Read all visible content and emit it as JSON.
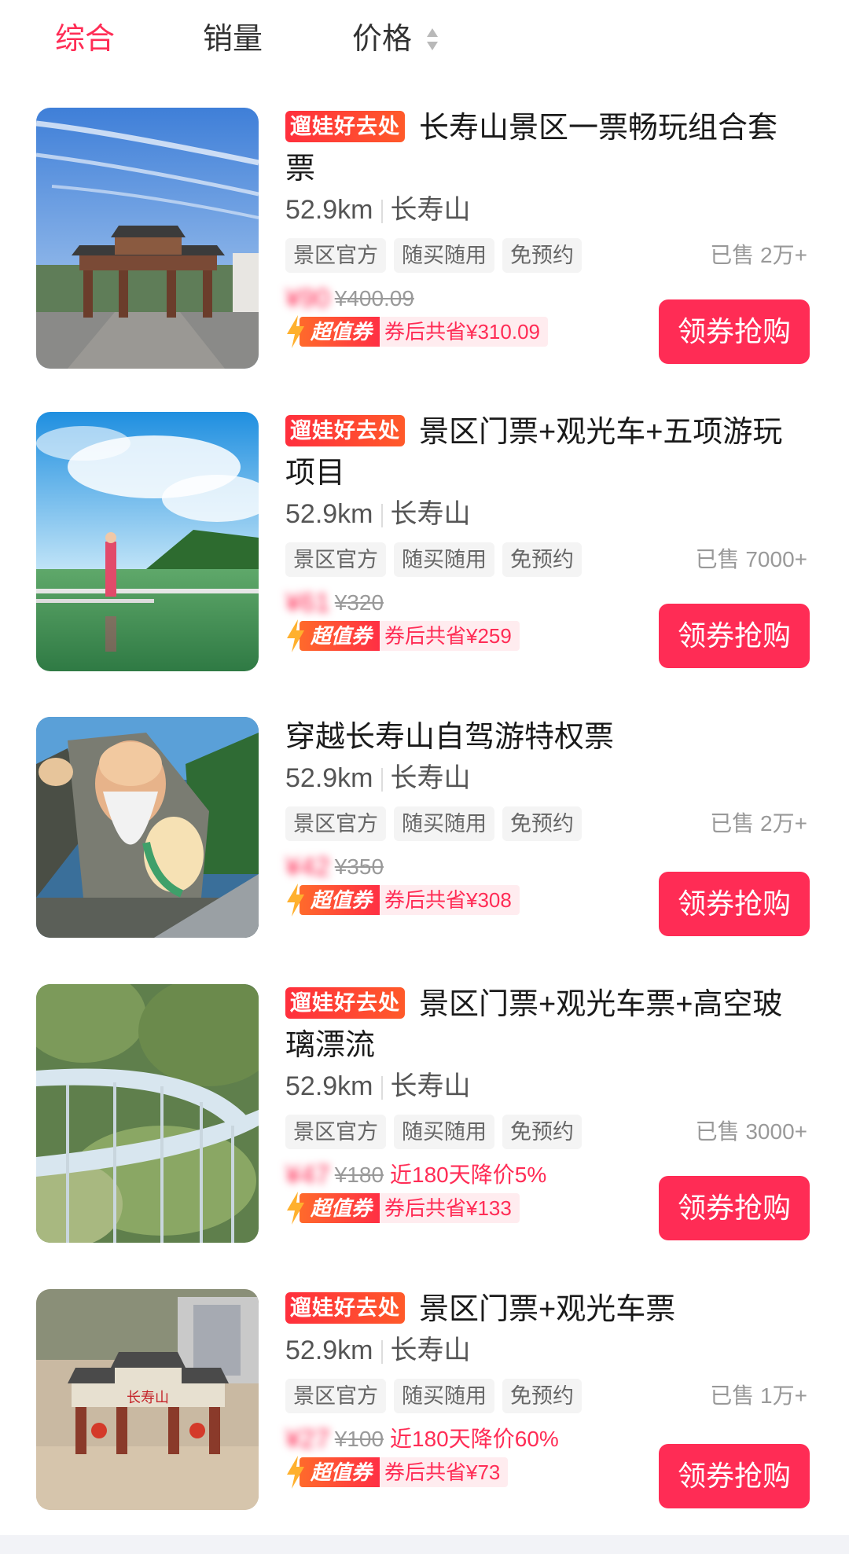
{
  "sort": {
    "items": [
      "综合",
      "销量",
      "价格"
    ],
    "active_index": 0
  },
  "colors": {
    "accent": "#ff2c55",
    "badge": "#ff3a33"
  },
  "products": [
    {
      "badge": "遛娃好去处",
      "title": "长寿山景区一票畅玩组合套票",
      "distance": "52.9km",
      "area": "长寿山",
      "tags": [
        "景区官方",
        "随买随用",
        "免预约"
      ],
      "sold": "已售 2万+",
      "price": "¥90",
      "original_price": "¥400.09",
      "price_drop": "",
      "coupon_label": "超值券",
      "coupon_save": "券后共省¥310.09",
      "buy_label": "领券抢购",
      "image": "arch-gate-blue-sky"
    },
    {
      "badge": "遛娃好去处",
      "title": "景区门票+观光车+五项游玩项目",
      "distance": "52.9km",
      "area": "长寿山",
      "tags": [
        "景区官方",
        "随买随用",
        "免预约"
      ],
      "sold": "已售 7000+",
      "price": "¥61",
      "original_price": "¥320",
      "price_drop": "",
      "coupon_label": "超值券",
      "coupon_save": "券后共省¥259",
      "buy_label": "领券抢购",
      "image": "lake-statue"
    },
    {
      "badge": "",
      "title": "穿越长寿山自驾游特权票",
      "distance": "52.9km",
      "area": "长寿山",
      "tags": [
        "景区官方",
        "随买随用",
        "免预约"
      ],
      "sold": "已售 2万+",
      "price": "¥42",
      "original_price": "¥350",
      "price_drop": "",
      "coupon_label": "超值券",
      "coupon_save": "券后共省¥308",
      "buy_label": "领券抢购",
      "image": "longevity-god-sculpture"
    },
    {
      "badge": "遛娃好去处",
      "title": "景区门票+观光车票+高空玻璃漂流",
      "distance": "52.9km",
      "area": "长寿山",
      "tags": [
        "景区官方",
        "随买随用",
        "免预约"
      ],
      "sold": "已售 3000+",
      "price": "¥47",
      "original_price": "¥180",
      "price_drop": "近180天降价5%",
      "coupon_label": "超值券",
      "coupon_save": "券后共省¥133",
      "buy_label": "领券抢购",
      "image": "glass-slide-forest"
    },
    {
      "badge": "遛娃好去处",
      "title": "景区门票+观光车票",
      "distance": "52.9km",
      "area": "长寿山",
      "tags": [
        "景区官方",
        "随买随用",
        "免预约"
      ],
      "sold": "已售 1万+",
      "price": "¥27",
      "original_price": "¥100",
      "price_drop": "近180天降价60%",
      "coupon_label": "超值券",
      "coupon_save": "券后共省¥73",
      "buy_label": "领券抢购",
      "image": "aerial-gate-plaza",
      "gate_text": "长寿山"
    }
  ]
}
